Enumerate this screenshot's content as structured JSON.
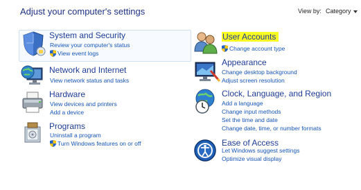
{
  "header": {
    "title": "Adjust your computer's settings",
    "view_by_label": "View by:",
    "view_by_value": "Category"
  },
  "categories": {
    "system_security": {
      "title": "System and Security",
      "links": [
        "Review your computer's status",
        "View event logs"
      ]
    },
    "network": {
      "title": "Network and Internet",
      "links": [
        "View network status and tasks"
      ]
    },
    "hardware": {
      "title": "Hardware",
      "links": [
        "View devices and printers",
        "Add a device"
      ]
    },
    "programs": {
      "title": "Programs",
      "links": [
        "Uninstall a program",
        "Turn Windows features on or off"
      ]
    },
    "user_accounts": {
      "title": "User Accounts",
      "links": [
        "Change account type"
      ]
    },
    "appearance": {
      "title": "Appearance",
      "links": [
        "Change desktop background",
        "Adjust screen resolution"
      ]
    },
    "clock": {
      "title": "Clock, Language, and Region",
      "links": [
        "Add a language",
        "Change input methods",
        "Set the time and date",
        "Change date, time, or number formats"
      ]
    },
    "ease": {
      "title": "Ease of Access",
      "links": [
        "Let Windows suggest settings",
        "Optimize visual display"
      ]
    }
  },
  "colors": {
    "title_text": "#1e3287",
    "category_title": "#1e3c96",
    "link": "#1655b8",
    "highlight": "#fbfb24",
    "selection_border": "#cfe0f2"
  }
}
